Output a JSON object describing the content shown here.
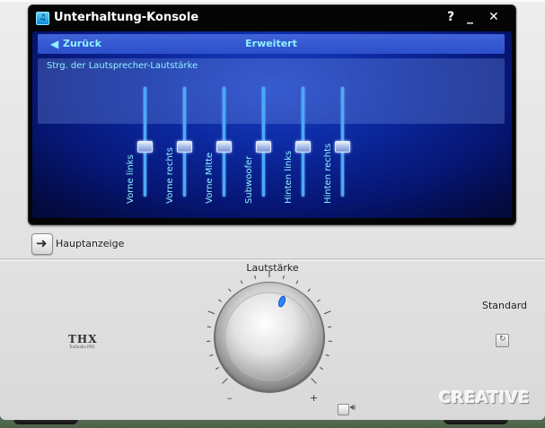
{
  "window": {
    "title": "Unterhaltung-Konsole",
    "help": "?",
    "minimize": "_",
    "close": "✕"
  },
  "panel": {
    "back_label": "Zurück",
    "header_title": "Erweitert",
    "subtitle": "Strg. der Lautsprecher-Lautstärke",
    "channels": [
      {
        "label": "Vorne links",
        "level": 0.5
      },
      {
        "label": "Vorne rechts",
        "level": 0.5
      },
      {
        "label": "Vorne Mitte",
        "level": 0.5
      },
      {
        "label": "Subwoofer",
        "level": 0.5
      },
      {
        "label": "Hinten links",
        "level": 0.5
      },
      {
        "label": "Hinten rechts",
        "level": 0.5
      }
    ]
  },
  "nav": {
    "home_label": "Hauptanzeige"
  },
  "volume": {
    "label": "Lautstärke",
    "minus": "–",
    "plus": "+"
  },
  "standard": {
    "label": "Standard"
  },
  "branding": {
    "thx": "THX",
    "thx_sub": "TruStudio PRO",
    "creative": "CREATIVE"
  },
  "colors": {
    "accent": "#8ff2ff",
    "panel": "#0c2aa2",
    "slider_track": "#4aa9ff"
  }
}
